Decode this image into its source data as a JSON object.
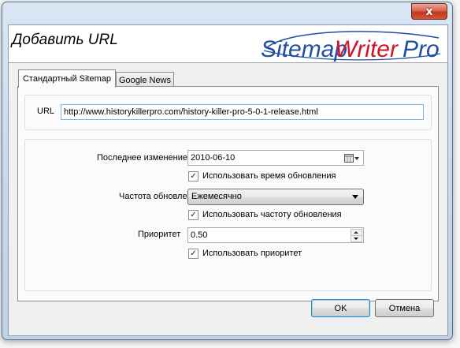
{
  "window": {
    "close_glyph": "x"
  },
  "header": {
    "title": "Добавить URL",
    "logo": {
      "part1": "Sitemap",
      "part2": "Writer",
      "part3": "Pro"
    }
  },
  "tabs": [
    {
      "label": "Стандартный Sitemap",
      "active": true
    },
    {
      "label": "Google News",
      "active": false
    }
  ],
  "url": {
    "label": "URL",
    "value": "http://www.historykillerpro.com/history-killer-pro-5-0-1-release.html"
  },
  "last_modified": {
    "label": "Последнее изменение",
    "value": "2010-06-10",
    "use_label": "Использовать время обновления",
    "use_checked": true
  },
  "change_freq": {
    "label": "Частота обновления",
    "value": "Ежемесячно",
    "use_label": "Использовать частоту обновления",
    "use_checked": true
  },
  "priority": {
    "label": "Приоритет",
    "value": "0.50",
    "use_label": "Использовать приоритет",
    "use_checked": true
  },
  "buttons": {
    "ok": "OK",
    "cancel": "Отмена"
  },
  "colors": {
    "logo_blue": "#1e4fa3",
    "logo_red": "#d0142a"
  }
}
